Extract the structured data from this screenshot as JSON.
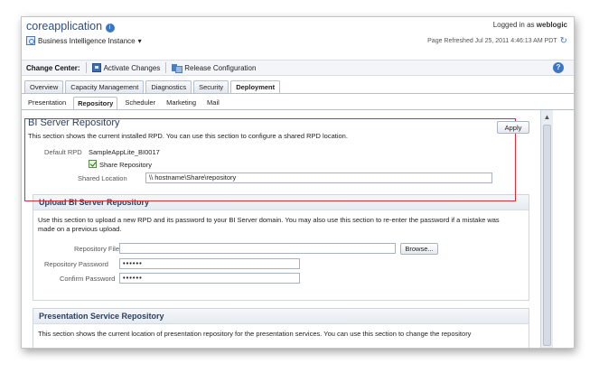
{
  "header": {
    "app_title": "coreapplication",
    "instance_label": "Business Intelligence Instance",
    "logged_in_prefix": "Logged in as",
    "logged_in_user": "weblogic",
    "refreshed": "Page Refreshed Jul 25, 2011 4:46:13 AM PDT"
  },
  "change_center": {
    "label": "Change Center:",
    "activate_label": "Activate Changes",
    "release_label": "Release Configuration"
  },
  "tabs_primary": [
    "Overview",
    "Capacity Management",
    "Diagnostics",
    "Security",
    "Deployment"
  ],
  "tabs_secondary": [
    "Presentation",
    "Repository",
    "Scheduler",
    "Marketing",
    "Mail"
  ],
  "bi_server_repo": {
    "title": "BI Server Repository",
    "description": "This section shows the current installed RPD. You can use this section to configure a shared RPD location.",
    "apply_label": "Apply",
    "default_rpd_label": "Default RPD",
    "default_rpd_value": "SampleAppLite_BI0017",
    "share_repo_label": "Share Repository",
    "shared_location_label": "Shared Location",
    "shared_location_value": "\\\\ hostname\\Share\\repository"
  },
  "upload_repo": {
    "title": "Upload BI Server Repository",
    "description": "Use this section to upload a new RPD and its password to your BI Server domain. You may also use this section to re-enter the password if a mistake was made on a previous upload.",
    "file_label": "Repository File",
    "browse_label": "Browse...",
    "password_label": "Repository Password",
    "password_value": "••••••",
    "confirm_label": "Confirm Password",
    "confirm_value": "••••••"
  },
  "presentation_repo": {
    "title": "Presentation Service Repository",
    "description": "This section shows the current location of presentation repository for the presentation services. You can use this section to change the repository"
  }
}
